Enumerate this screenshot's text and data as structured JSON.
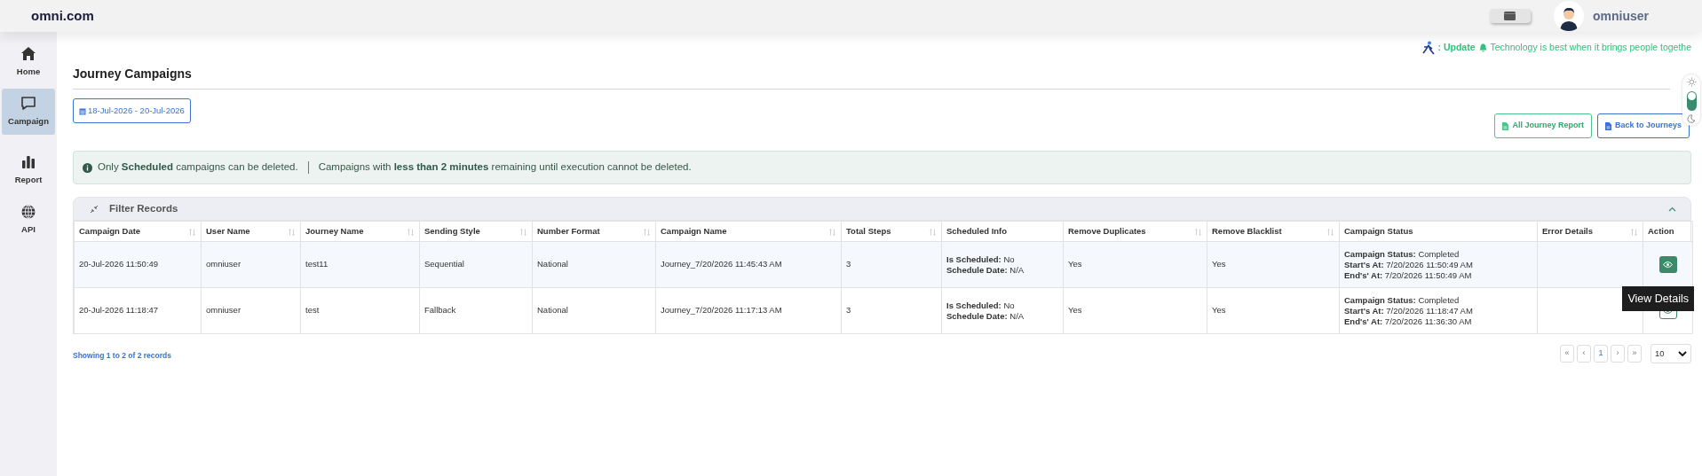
{
  "header": {
    "logo": "omni.com",
    "username": "omniuser"
  },
  "sidebar": {
    "items": [
      {
        "label": "Home",
        "selected": false
      },
      {
        "label": "Campaign",
        "selected": true
      },
      {
        "label": "Report",
        "selected": false
      },
      {
        "label": "API",
        "selected": false
      }
    ]
  },
  "ticker": {
    "label": ": Update",
    "text": "Technology is best when it brings people togethe"
  },
  "theme_toggle": {
    "dark": false
  },
  "page": {
    "title": "Journey Campaigns",
    "date_range": "18-Jul-2026 - 20-Jul-2026",
    "buttons": [
      {
        "label": "All Journey Report",
        "kind": "green"
      },
      {
        "label": "Back to Journeys",
        "kind": "blue"
      }
    ]
  },
  "alert": {
    "parts": [
      "Only **Scheduled** campaigns can be deleted.",
      "Campaigns with **less than 2 minutes** remaining until execution cannot be deleted."
    ]
  },
  "filter": {
    "title": "Filter Records",
    "expanded": true
  },
  "table": {
    "columns": [
      {
        "label": "Campaign Date",
        "sortable": true
      },
      {
        "label": "User Name",
        "sortable": true
      },
      {
        "label": "Journey Name",
        "sortable": true
      },
      {
        "label": "Sending Style",
        "sortable": true
      },
      {
        "label": "Number Format",
        "sortable": true
      },
      {
        "label": "Campaign Name",
        "sortable": true
      },
      {
        "label": "Total Steps",
        "sortable": true
      },
      {
        "label": "Scheduled Info",
        "sortable": false
      },
      {
        "label": "Remove Duplicates",
        "sortable": true
      },
      {
        "label": "Remove Blacklist",
        "sortable": true
      },
      {
        "label": "Campaign Status",
        "sortable": false
      },
      {
        "label": "Error Details",
        "sortable": true
      },
      {
        "label": "Action",
        "sortable": false
      }
    ],
    "rows": [
      {
        "cells": [
          "20-Jul-2026 11:50:49",
          "omniuser",
          "test11",
          "Sequential",
          "National",
          "Journey_7/20/2026 11:45:43 AM",
          "3"
        ],
        "scheduled_info": [
          {
            "label": "Is Scheduled:",
            "value": "No"
          },
          {
            "label": "Schedule Date:",
            "value": "N/A"
          }
        ],
        "remove_duplicates": "Yes",
        "remove_blacklist": "Yes",
        "campaign_status": [
          {
            "label": "Campaign Status:",
            "value": "Completed"
          },
          {
            "label": "Start's At:",
            "value": "7/20/2026 11:50:49 AM"
          },
          {
            "label": "End's' At:",
            "value": "7/20/2026 11:50:49 AM"
          }
        ]
      },
      {
        "cells": [
          "20-Jul-2026 11:18:47",
          "omniuser",
          "test",
          "Fallback",
          "National",
          "Journey_7/20/2026 11:17:13 AM",
          "3"
        ],
        "scheduled_info": [
          {
            "label": "Is Scheduled:",
            "value": "No"
          },
          {
            "label": "Schedule Date:",
            "value": "N/A"
          }
        ],
        "remove_duplicates": "Yes",
        "remove_blacklist": "Yes",
        "campaign_status": [
          {
            "label": "Campaign Status:",
            "value": "Completed"
          },
          {
            "label": "Start's At:",
            "value": "7/20/2026 11:18:47 AM"
          },
          {
            "label": "End's' At:",
            "value": "7/20/2026 11:36:30 AM"
          }
        ]
      }
    ],
    "tooltip": "View Details"
  },
  "footer": {
    "summary": "Showing 1 to 2 of 2 records",
    "pages": [
      {
        "label": "«",
        "selected": false
      },
      {
        "label": "‹",
        "selected": false
      },
      {
        "label": "1",
        "selected": true
      },
      {
        "label": "›",
        "selected": false
      },
      {
        "label": "»",
        "selected": false
      }
    ],
    "page_size": "10"
  }
}
